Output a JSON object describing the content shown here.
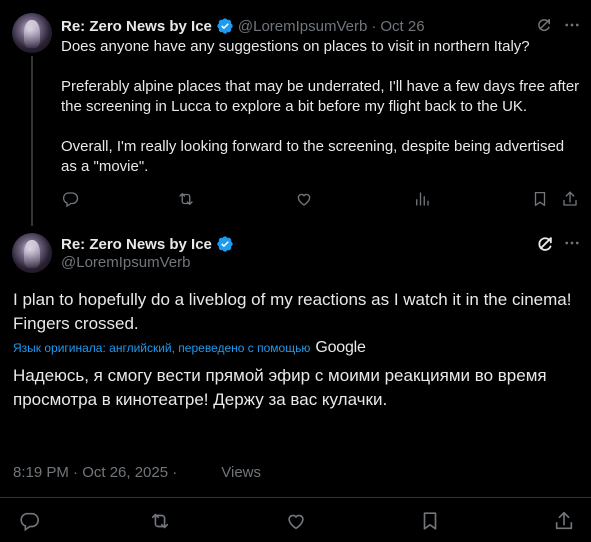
{
  "parent_tweet": {
    "author_name": "Re: Zero News by Ice",
    "handle": "@LoremIpsumVerb",
    "separator": "·",
    "time": "Oct 26",
    "paragraphs": [
      "Does anyone have any suggestions on places to visit in northern Italy?",
      "Preferably alpine places that may be underrated, I'll have a few days free after the screening in Lucca to explore a bit before my flight back to the UK.",
      "Overall, I'm really looking forward to the screening, despite being advertised as a \"movie\"."
    ]
  },
  "main_tweet": {
    "author_name": "Re: Zero News by Ice",
    "handle": "@LoremIpsumVerb",
    "text": "I plan to hopefully do a liveblog of my reactions as I watch it in the cinema! Fingers crossed.",
    "translation_note": "Язык оригинала: английский, переведено с помощью",
    "translation_provider": "Google",
    "translated_text": "Надеюсь, я смогу вести прямой эфир с моими реакциями во время просмотра в кинотеатре! Держу за вас кулачки.",
    "timestamp": "8:19 PM · Oct 26, 2025 ·",
    "views_label": "Views"
  },
  "icons": {
    "verified": "verified-badge-icon",
    "grok": "grok-icon",
    "more": "more-icon",
    "reply": "reply-icon",
    "repost": "repost-icon",
    "like": "like-icon",
    "views": "views-icon",
    "bookmark": "bookmark-icon",
    "share": "share-icon"
  },
  "colors": {
    "background": "#000000",
    "text": "#e7e9ea",
    "muted": "#71767b",
    "accent": "#1d9bf0",
    "divider": "#2f3336"
  }
}
